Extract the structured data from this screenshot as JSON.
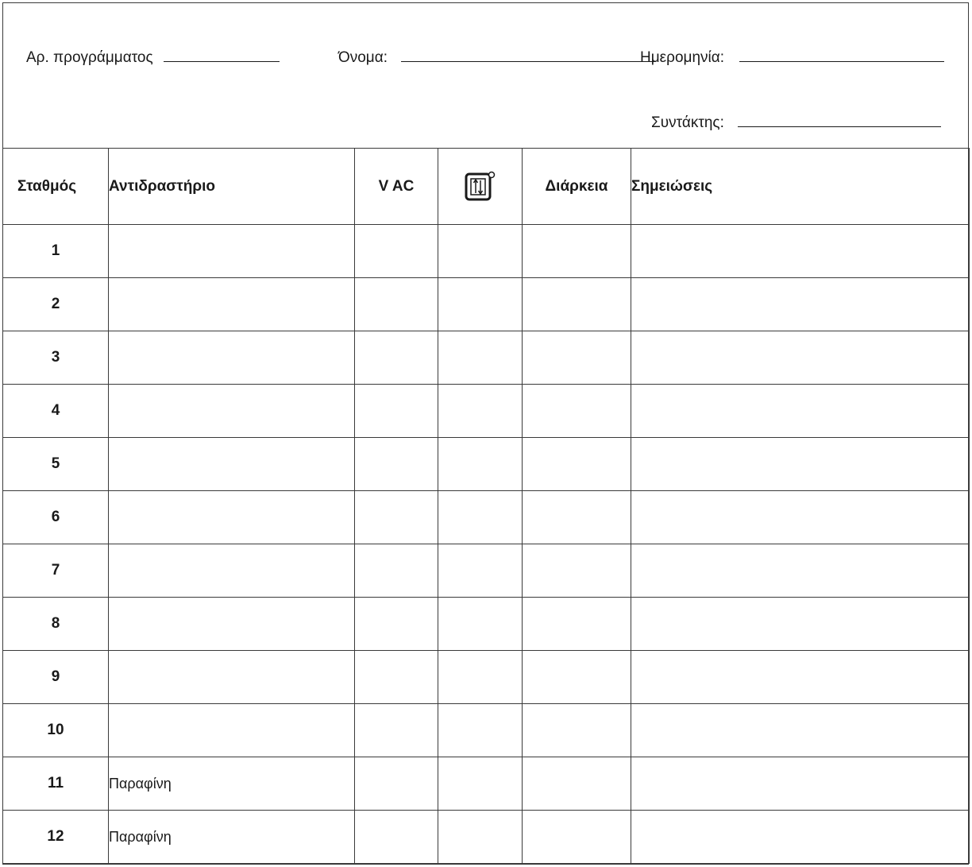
{
  "header": {
    "program_label": "Αρ. προγράμματος",
    "name_label": "Όνομα:",
    "date_label": "Ημερομηνία:",
    "author_label": "Συντάκτης:"
  },
  "table": {
    "columns": {
      "station": "Σταθμός",
      "reagent": "Αντιδραστήριο",
      "vac": "V AC",
      "mode_icon": "stir-mode-icon",
      "duration": "Διάρκεια",
      "notes": "Σημειώσεις"
    },
    "rows": [
      {
        "station": "1",
        "reagent": ""
      },
      {
        "station": "2",
        "reagent": ""
      },
      {
        "station": "3",
        "reagent": ""
      },
      {
        "station": "4",
        "reagent": ""
      },
      {
        "station": "5",
        "reagent": ""
      },
      {
        "station": "6",
        "reagent": ""
      },
      {
        "station": "7",
        "reagent": ""
      },
      {
        "station": "8",
        "reagent": ""
      },
      {
        "station": "9",
        "reagent": ""
      },
      {
        "station": "10",
        "reagent": ""
      },
      {
        "station": "11",
        "reagent": "Παραφίνη"
      },
      {
        "station": "12",
        "reagent": "Παραφίνη"
      }
    ]
  }
}
